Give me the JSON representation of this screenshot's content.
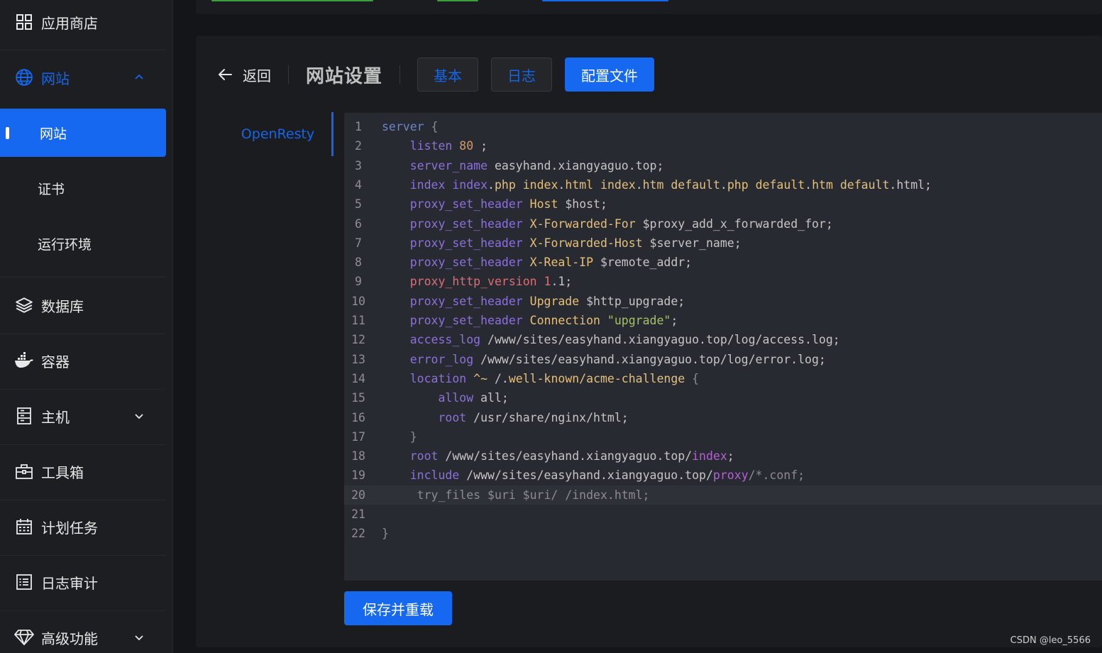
{
  "sidebar": {
    "items": [
      {
        "label": "应用商店",
        "icon": "grid-icon"
      },
      {
        "label": "网站",
        "icon": "globe-icon",
        "expanded": true
      },
      {
        "label": "网站",
        "sub": true,
        "selected": true
      },
      {
        "label": "证书",
        "sub": true
      },
      {
        "label": "运行环境",
        "sub": true
      },
      {
        "label": "数据库",
        "icon": "layers-icon"
      },
      {
        "label": "容器",
        "icon": "docker-icon"
      },
      {
        "label": "主机",
        "icon": "server-icon",
        "collapsible": true
      },
      {
        "label": "工具箱",
        "icon": "toolbox-icon"
      },
      {
        "label": "计划任务",
        "icon": "calendar-icon"
      },
      {
        "label": "日志审计",
        "icon": "log-icon"
      },
      {
        "label": "高级功能",
        "icon": "diamond-icon",
        "collapsible": true
      }
    ]
  },
  "header": {
    "back_label": "返回",
    "title": "网站设置",
    "tabs": [
      {
        "label": "基本",
        "active": false
      },
      {
        "label": "日志",
        "active": false
      },
      {
        "label": "配置文件",
        "active": true
      }
    ]
  },
  "side_tab": {
    "label": "OpenResty"
  },
  "editor": {
    "line_numbers": [
      "1",
      "2",
      "3",
      "4",
      "5",
      "6",
      "7",
      "8",
      "9",
      "10",
      "11",
      "12",
      "13",
      "14",
      "15",
      "16",
      "17",
      "18",
      "19",
      "20",
      "21",
      "22"
    ],
    "current_line": 20
  },
  "save_button": {
    "label": "保存并重载"
  },
  "watermark": "CSDN @leo_5566",
  "colors": {
    "accent": "#1668f0",
    "panel": "#1b1c1f",
    "editor_bg": "#272a31",
    "sidebar": "#1d1e21"
  }
}
